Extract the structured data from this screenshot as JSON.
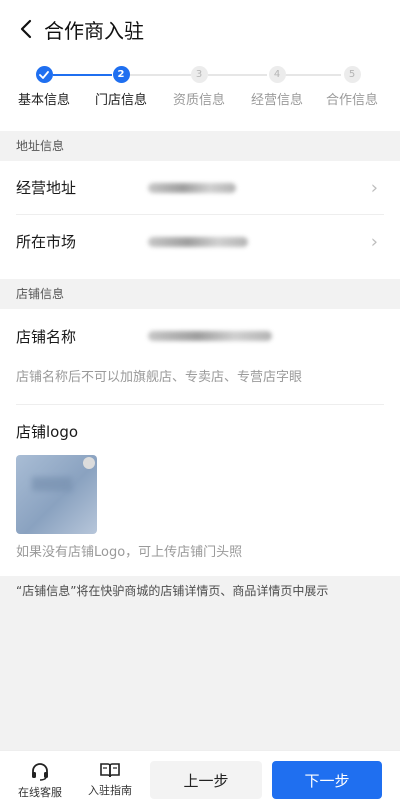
{
  "header": {
    "title": "合作商入驻"
  },
  "stepper": {
    "steps": [
      {
        "num": "",
        "label": "基本信息",
        "state": "done"
      },
      {
        "num": "2",
        "label": "门店信息",
        "state": "active"
      },
      {
        "num": "3",
        "label": "资质信息",
        "state": "todo"
      },
      {
        "num": "4",
        "label": "经营信息",
        "state": "todo"
      },
      {
        "num": "5",
        "label": "合作信息",
        "state": "todo"
      }
    ]
  },
  "address_section": {
    "title": "地址信息",
    "business_address_label": "经营地址",
    "market_label": "所在市场"
  },
  "store_section": {
    "title": "店铺信息",
    "store_name_label": "店铺名称",
    "store_name_hint": "店铺名称后不可以加旗舰店、专卖店、专营店字眼",
    "logo_label": "店铺logo",
    "logo_hint": "如果没有店铺Logo，可上传店铺门头照"
  },
  "note": "“店铺信息”将在快驴商城的店铺详情页、商品详情页中展示",
  "bottom": {
    "service_label": "在线客服",
    "guide_label": "入驻指南",
    "prev_label": "上一步",
    "next_label": "下一步"
  },
  "colors": {
    "accent": "#1f6ff0",
    "section_bg": "#f2f2f2"
  },
  "icons": [
    "back-arrow-icon",
    "check-icon",
    "chevron-right-icon",
    "headset-icon",
    "book-icon"
  ]
}
